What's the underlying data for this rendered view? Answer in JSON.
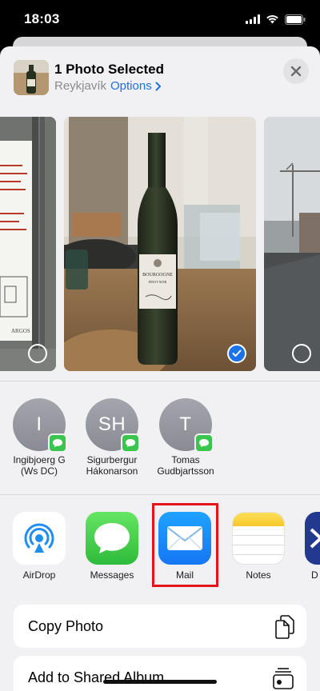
{
  "status_bar": {
    "time": "18:03"
  },
  "header": {
    "title": "1 Photo Selected",
    "location": "Reykjavík",
    "options_label": "Options"
  },
  "contacts": [
    {
      "initials": "I",
      "name_line1": "Ingibjoerg G",
      "name_line2": "(Ws DC)"
    },
    {
      "initials": "SH",
      "name_line1": "Sigurbergur",
      "name_line2": "Hákonarson"
    },
    {
      "initials": "T",
      "name_line1": "Tomas",
      "name_line2": "Gudbjartsson"
    }
  ],
  "apps": [
    {
      "label": "AirDrop"
    },
    {
      "label": "Messages"
    },
    {
      "label": "Mail"
    },
    {
      "label": "Notes"
    },
    {
      "label": "D"
    }
  ],
  "actions": [
    {
      "label": "Copy Photo"
    },
    {
      "label": "Add to Shared Album"
    }
  ],
  "photos": {
    "left_sign_text": "ARGOS",
    "bottle_label_main": "BOURGOGNE",
    "bottle_label_sub": "PINOT NOIR"
  },
  "colors": {
    "accent_blue": "#1a73e8",
    "highlight_red": "#e3151b",
    "sheet_background": "#f1f1f3",
    "message_green": "#3ac54f"
  }
}
